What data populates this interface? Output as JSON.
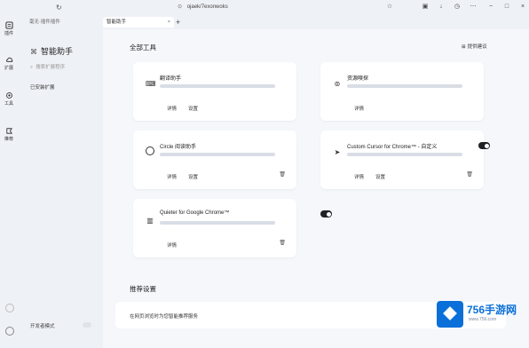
{
  "browser": {
    "address": "ojaek/7exonwoks",
    "tabs": [
      {
        "label": "毫无·插件插件",
        "active": false
      },
      {
        "label": "智能助手",
        "active": true
      }
    ],
    "newtab": "+"
  },
  "rail": {
    "items": [
      {
        "label": "插件",
        "icon": "puzzle-icon"
      },
      {
        "label": "扩展",
        "icon": "cloud-icon"
      },
      {
        "label": "工具",
        "icon": "gear-icon"
      },
      {
        "label": "推荐",
        "icon": "flag-icon"
      }
    ]
  },
  "sidebar": {
    "title": "智能助手",
    "search_placeholder": "搜索扩展程序",
    "selected_item": "已安装扩展",
    "footer": "开发者模式"
  },
  "main": {
    "section_title": "全部工具",
    "feedback_link": "提供建议",
    "cards": [
      {
        "title": "翻译助手",
        "action1": "详情",
        "action2": "设置",
        "icon": "translate-icon",
        "enabled": true,
        "has_trash": false
      },
      {
        "title": "资源嗅探",
        "action1": "详情",
        "action2": "",
        "icon": "broadcast-icon",
        "enabled": false,
        "has_trash": false
      },
      {
        "title": "Circle 阅读助手",
        "action1": "详情",
        "action2": "设置",
        "icon": "circle-icon",
        "enabled": true,
        "has_trash": true
      },
      {
        "title": "Custom Cursor for Chrome™ - 自定义",
        "action1": "详情",
        "action2": "设置",
        "icon": "cursor-icon",
        "enabled": true,
        "has_trash": true
      },
      {
        "title": "Quieter for Google Chrome™",
        "action1": "详情",
        "action2": "",
        "icon": "window-icon",
        "enabled": true,
        "has_trash": true
      }
    ],
    "recommend_title": "推荐设置",
    "recommend_text": "在网页浏览时为您智能推荐服务"
  },
  "watermark": {
    "brand": "756手游网",
    "sub": "www.756.com"
  }
}
